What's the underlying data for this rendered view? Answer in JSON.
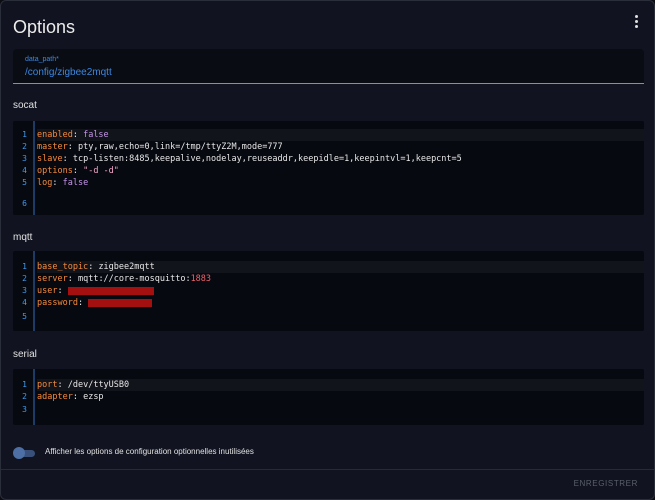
{
  "header": {
    "title": "Options"
  },
  "data_path": {
    "label": "data_path*",
    "value": "/config/zigbee2mqtt"
  },
  "sections": {
    "socat": {
      "title": "socat",
      "line_numbers": [
        "1",
        "2",
        "3",
        "4",
        "5",
        "6"
      ],
      "lines": [
        {
          "key": "enabled",
          "sep": ": ",
          "value": "false"
        },
        {
          "key": "master",
          "sep": ": ",
          "value": "pty,raw,echo=0,link=/tmp/ttyZ2M,mode=777"
        },
        {
          "key": "slave",
          "sep": ": ",
          "value": "tcp-listen:8485,keepalive,nodelay,reuseaddr,keepidle=1,keepintvl=1,keepcnt=5"
        },
        {
          "key": "options",
          "sep": ": ",
          "value": "\"-d -d\""
        },
        {
          "key": "log",
          "sep": ": ",
          "value": "false"
        }
      ]
    },
    "mqtt": {
      "title": "mqtt",
      "line_numbers": [
        "1",
        "2",
        "3",
        "4",
        "5"
      ],
      "lines": [
        {
          "key": "base_topic",
          "sep": ": ",
          "value": "zigbee2mqtt"
        },
        {
          "key": "server",
          "sep": ": ",
          "value": "mqtt://core-mosquitto",
          "port": "1883"
        },
        {
          "key": "user",
          "sep": ": "
        },
        {
          "key": "password",
          "sep": ": "
        }
      ]
    },
    "serial": {
      "title": "serial",
      "line_numbers": [
        "1",
        "2",
        "3"
      ],
      "lines": [
        {
          "key": "port",
          "sep": ": ",
          "value": "/dev/ttyUSB0"
        },
        {
          "key": "adapter",
          "sep": ": ",
          "value": "ezsp"
        }
      ]
    }
  },
  "toggle": {
    "label": "Afficher les options de configuration optionnelles inutilisées",
    "checked": false
  },
  "footer": {
    "save_label": "ENREGISTRER"
  },
  "colors": {
    "accent": "#3b87e0",
    "key": "#f48a3a",
    "boolean": "#c594e8",
    "string": "#f1a6c9",
    "number": "#f0626b",
    "redaction": "#a40f0f"
  }
}
